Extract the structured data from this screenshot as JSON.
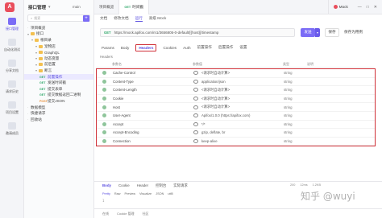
{
  "rail": {
    "logo": "A",
    "items": [
      {
        "label": "接口管理",
        "active": true
      },
      {
        "label": "自动化测试",
        "active": false
      },
      {
        "label": "分享文档",
        "active": false
      },
      {
        "label": "请求历史",
        "active": false
      },
      {
        "label": "项目设置",
        "active": false
      },
      {
        "label": "邀请成员",
        "active": false
      }
    ]
  },
  "tree": {
    "title": "接口管理",
    "member": "main",
    "search_placeholder": "搜索",
    "rows": [
      {
        "label": "项目概览",
        "indent": 0,
        "method": "",
        "folder": false
      },
      {
        "label": "接口",
        "indent": 0,
        "method": "",
        "folder": true
      },
      {
        "label": "根目录",
        "indent": 1,
        "method": "",
        "folder": true
      },
      {
        "label": "宠物店",
        "indent": 2,
        "method": "",
        "folder": true
      },
      {
        "label": "GraphQL",
        "indent": 2,
        "method": "",
        "folder": true
      },
      {
        "label": "动态变量",
        "indent": 2,
        "method": "",
        "folder": true
      },
      {
        "label": "前后置",
        "indent": 2,
        "method": "",
        "folder": true
      },
      {
        "label": "断言",
        "indent": 2,
        "method": "",
        "folder": true
      },
      {
        "label": "前置操作",
        "indent": 3,
        "method": "GET",
        "folder": false,
        "active": true
      },
      {
        "label": "发送时间戳",
        "indent": 3,
        "method": "GET",
        "folder": false
      },
      {
        "label": "提交表单",
        "indent": 3,
        "method": "GET",
        "folder": false
      },
      {
        "label": "提交数据返回二进制",
        "indent": 3,
        "method": "GET",
        "folder": false
      },
      {
        "label": "提交JSON",
        "indent": 3,
        "method": "POST",
        "folder": false
      },
      {
        "label": "数据模型",
        "indent": 0,
        "method": "",
        "folder": false
      },
      {
        "label": "快捷请求",
        "indent": 0,
        "method": "",
        "folder": false
      },
      {
        "label": "回收站",
        "indent": 0,
        "method": "",
        "folder": false
      }
    ]
  },
  "tabs": [
    {
      "label": "项目概览",
      "method": "",
      "active": false
    },
    {
      "label": "时间戳",
      "method": "GET",
      "active": true
    }
  ],
  "env": {
    "label": "Mock"
  },
  "window": {
    "min": "—",
    "max": "□",
    "close": "✕"
  },
  "subtabs": [
    {
      "label": "文档",
      "active": false
    },
    {
      "label": "修改文档",
      "active": false
    },
    {
      "label": "运行",
      "active": true
    },
    {
      "label": "高级 Mock",
      "active": false
    }
  ],
  "url": {
    "method": "GET",
    "value": "https://mock.apifox.com/m1/3656805-0-default/[{host}]/timestamp"
  },
  "send_label": "发送",
  "save_label": "保存",
  "save_test_label": "保存为用例",
  "param_tabs": [
    {
      "label": "Params",
      "active": false
    },
    {
      "label": "Body",
      "active": false
    },
    {
      "label": "Headers",
      "active": true
    },
    {
      "label": "Cookies",
      "active": false
    },
    {
      "label": "Auth",
      "active": false
    },
    {
      "label": "前置操作",
      "active": false
    },
    {
      "label": "后置操作",
      "active": false
    },
    {
      "label": "设置",
      "active": false
    }
  ],
  "headers_label": "Headers",
  "table": {
    "columns": [
      "参数名",
      "参数值",
      "类型",
      "说明"
    ],
    "rows": [
      {
        "key": "Cache-Control",
        "value": "<请求时自动计算>",
        "type": "string"
      },
      {
        "key": "Content-Type",
        "value": "application/json",
        "type": "string"
      },
      {
        "key": "Content-Length",
        "value": "<请求时自动计算>",
        "type": "string"
      },
      {
        "key": "Cookie",
        "value": "<请求时自动计算>",
        "type": "string"
      },
      {
        "key": "Host",
        "value": "<请求时自动计算>",
        "type": "string"
      },
      {
        "key": "User-Agent",
        "value": "Apifox/1.0.0 (https://apifox.com)",
        "type": "string"
      },
      {
        "key": "Accept",
        "value": "*/*",
        "type": "string"
      },
      {
        "key": "Accept-Encoding",
        "value": "gzip, deflate, br",
        "type": "string"
      },
      {
        "key": "Connection",
        "value": "keep-alive",
        "type": "string"
      }
    ]
  },
  "response": {
    "tabs": [
      {
        "label": "Body",
        "active": true
      },
      {
        "label": "Cookie",
        "active": false
      },
      {
        "label": "Header",
        "active": false
      },
      {
        "label": "控制台",
        "active": false
      },
      {
        "label": "实际请求",
        "active": false
      }
    ],
    "meta": [
      "200",
      "12ms",
      "1.2KB"
    ],
    "formats": [
      {
        "label": "Pretty",
        "active": true
      },
      {
        "label": "Raw",
        "active": false
      },
      {
        "label": "Preview",
        "active": false
      },
      {
        "label": "Visualize",
        "active": false
      },
      {
        "label": "JSON",
        "active": false
      },
      {
        "label": "utf8",
        "active": false
      }
    ],
    "code": "1"
  },
  "status_bar": [
    "在线",
    "Cookie 管理",
    "社区"
  ],
  "watermark": "知乎 @wuyi"
}
